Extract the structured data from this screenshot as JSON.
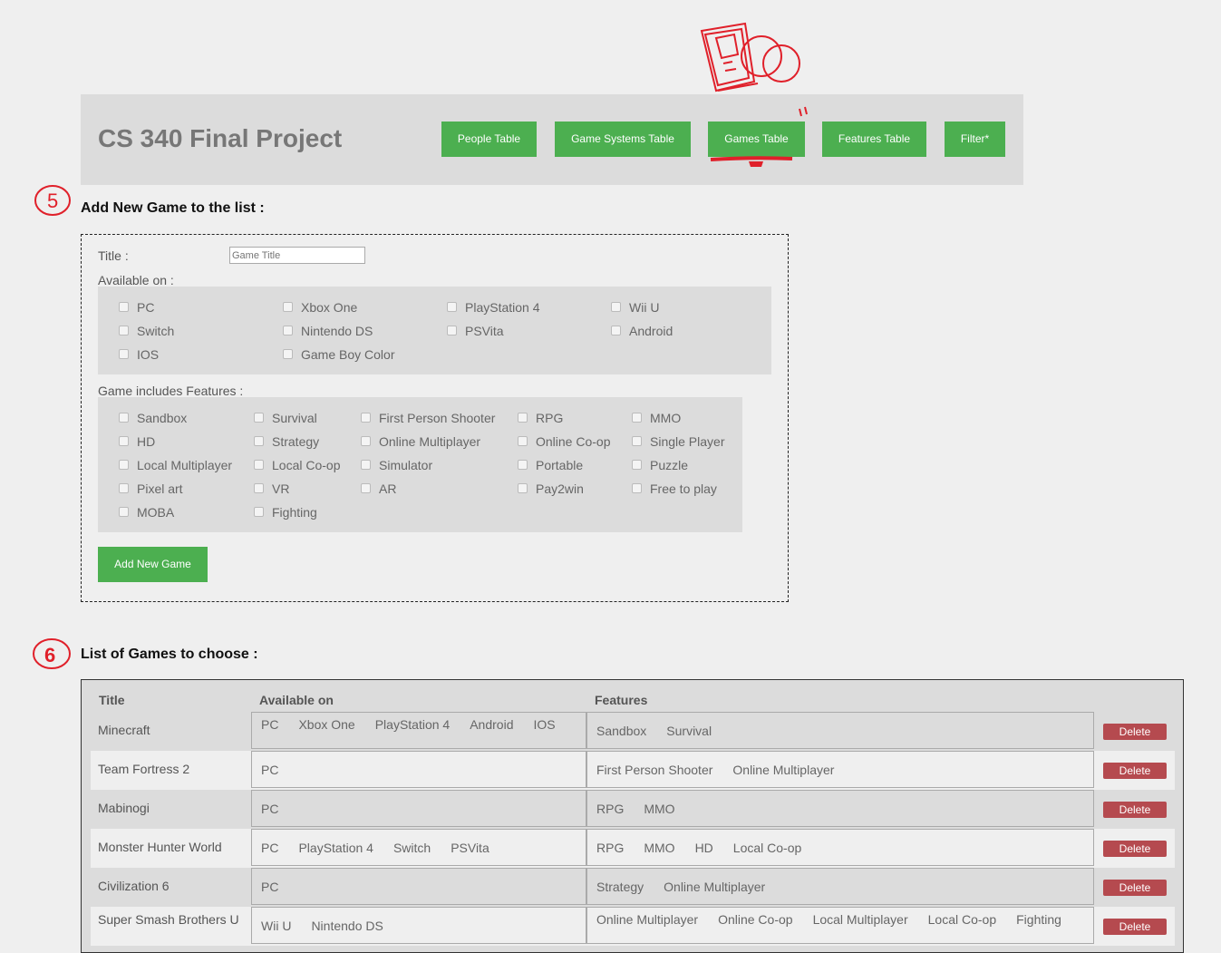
{
  "header": {
    "title": "CS 340 Final Project",
    "nav": [
      "People Table",
      "Game Systems Table",
      "Games Table",
      "Features Table",
      "Filter*"
    ]
  },
  "form": {
    "heading": "Add New Game to the list :",
    "title_label": "Title :",
    "title_placeholder": "Game Title",
    "available_label": "Available on :",
    "systems": [
      "PC",
      "Xbox One",
      "PlayStation 4",
      "Wii U",
      "Switch",
      "Nintendo DS",
      "PSVita",
      "Android",
      "IOS",
      "Game Boy Color"
    ],
    "features_label": "Game includes Features :",
    "features": [
      "Sandbox",
      "Survival",
      "First Person Shooter",
      "RPG",
      "MMO",
      "HD",
      "Strategy",
      "Online Multiplayer",
      "Online Co-op",
      "Single Player",
      "Local Multiplayer",
      "Local Co-op",
      "Simulator",
      "Portable",
      "Puzzle",
      "Pixel art",
      "VR",
      "AR",
      "Pay2win",
      "Free to play",
      "MOBA",
      "Fighting"
    ],
    "submit_label": "Add New Game"
  },
  "list": {
    "heading": "List of Games to choose :",
    "columns": [
      "Title",
      "Available on",
      "Features"
    ],
    "delete_label": "Delete",
    "rows": [
      {
        "title": "Minecraft",
        "available": [
          "PC",
          "Xbox One",
          "PlayStation 4",
          "Android",
          "IOS"
        ],
        "features": [
          "Sandbox",
          "Survival"
        ]
      },
      {
        "title": "Team Fortress 2",
        "available": [
          "PC"
        ],
        "features": [
          "First Person Shooter",
          "Online Multiplayer"
        ]
      },
      {
        "title": "Mabinogi",
        "available": [
          "PC"
        ],
        "features": [
          "RPG",
          "MMO"
        ]
      },
      {
        "title": "Monster Hunter World",
        "available": [
          "PC",
          "PlayStation 4",
          "Switch",
          "PSVita"
        ],
        "features": [
          "RPG",
          "MMO",
          "HD",
          "Local Co-op"
        ]
      },
      {
        "title": "Civilization 6",
        "available": [
          "PC"
        ],
        "features": [
          "Strategy",
          "Online Multiplayer"
        ]
      },
      {
        "title": "Super Smash Brothers U",
        "available": [
          "Wii U",
          "Nintendo DS"
        ],
        "features": [
          "Online Multiplayer",
          "Online Co-op",
          "Local Multiplayer",
          "Local Co-op",
          "Fighting"
        ]
      }
    ]
  },
  "annotations": {
    "five": "5",
    "six": "6"
  },
  "colors": {
    "accent": "#4caf50",
    "danger": "#b54a4f",
    "annotation": "#e0202a",
    "panel": "#dcdcdc"
  }
}
